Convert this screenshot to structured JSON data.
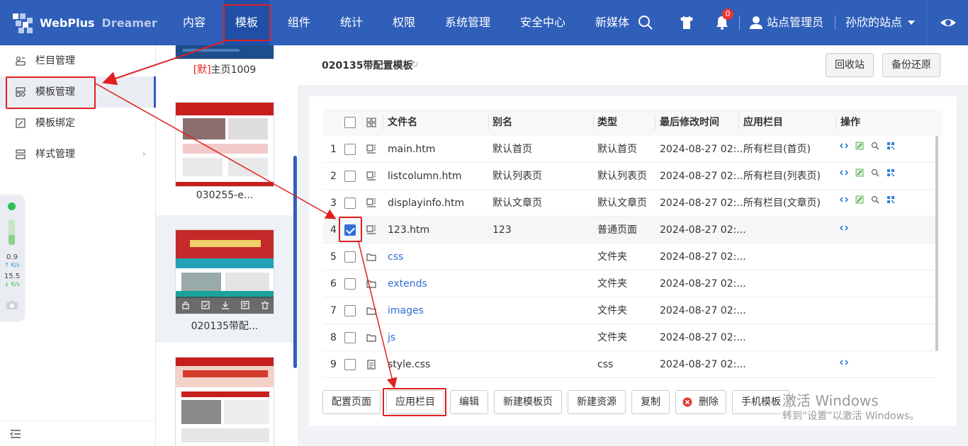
{
  "brand": {
    "name": "WebPlus",
    "sub": "Dreamer"
  },
  "nav": [
    "内容",
    "模板",
    "组件",
    "统计",
    "权限",
    "系统管理",
    "安全中心",
    "新媒体"
  ],
  "top": {
    "notifications": "0",
    "user": "站点管理员",
    "site": "孙欣的站点"
  },
  "sidebar": {
    "items": [
      {
        "label": "栏目管理",
        "icon": "columns-icon"
      },
      {
        "label": "模板管理",
        "icon": "template-icon"
      },
      {
        "label": "模板绑定",
        "icon": "bind-icon"
      },
      {
        "label": "样式管理",
        "icon": "style-icon"
      }
    ]
  },
  "widget": {
    "up_speed": "0.9",
    "up_unit": "K/s",
    "down_speed": "15.5",
    "down_unit": "K/s"
  },
  "templates": [
    {
      "name_prefix": "[默]",
      "name": "主页1009"
    },
    {
      "name": "030255-e..."
    },
    {
      "name": "020135带配..."
    },
    {
      "name": ""
    }
  ],
  "main": {
    "title": "020135带配置模板",
    "recycle": "回收站",
    "backup": "备份还原"
  },
  "table": {
    "headers": [
      "文件名",
      "别名",
      "类型",
      "最后修改时间",
      "应用栏目",
      "操作"
    ],
    "rows": [
      {
        "no": "1",
        "name": "main.htm",
        "alias": "默认首页",
        "type": "默认首页",
        "time": "2024-08-27 02:...",
        "col": "所有栏目(首页)",
        "kind": "page",
        "checked": false,
        "ops": 4
      },
      {
        "no": "2",
        "name": "listcolumn.htm",
        "alias": "默认列表页",
        "type": "默认列表页",
        "time": "2024-08-27 02:...",
        "col": "所有栏目(列表页)",
        "kind": "page",
        "checked": false,
        "ops": 4
      },
      {
        "no": "3",
        "name": "displayinfo.htm",
        "alias": "默认文章页",
        "type": "默认文章页",
        "time": "2024-08-27 02:...",
        "col": "所有栏目(文章页)",
        "kind": "page",
        "checked": false,
        "ops": 4
      },
      {
        "no": "4",
        "name": "123.htm",
        "alias": "123",
        "type": "普通页面",
        "time": "2024-08-27 02:...",
        "col": "",
        "kind": "page",
        "checked": true,
        "ops": 1
      },
      {
        "no": "5",
        "name": "css",
        "alias": "",
        "type": "文件夹",
        "time": "2024-08-27 02:...",
        "col": "",
        "kind": "folder",
        "checked": false,
        "ops": 0
      },
      {
        "no": "6",
        "name": "extends",
        "alias": "",
        "type": "文件夹",
        "time": "2024-08-27 02:...",
        "col": "",
        "kind": "folder",
        "checked": false,
        "ops": 0
      },
      {
        "no": "7",
        "name": "images",
        "alias": "",
        "type": "文件夹",
        "time": "2024-08-27 02:...",
        "col": "",
        "kind": "folder",
        "checked": false,
        "ops": 0
      },
      {
        "no": "8",
        "name": "js",
        "alias": "",
        "type": "文件夹",
        "time": "2024-08-27 02:...",
        "col": "",
        "kind": "folder",
        "checked": false,
        "ops": 0
      },
      {
        "no": "9",
        "name": "style.css",
        "alias": "",
        "type": "css",
        "time": "2024-08-27 02:...",
        "col": "",
        "kind": "file",
        "checked": false,
        "ops": 1
      }
    ]
  },
  "actions": [
    "配置页面",
    "应用栏目",
    "编辑",
    "新建模板页",
    "新建资源",
    "复制",
    "删除",
    "手机模板"
  ],
  "watermark": {
    "line1": "激活 Windows",
    "line2": "转到“设置”以激活 Windows。"
  },
  "colors": {
    "primary": "#2f5fb9",
    "highlight": "#e02020",
    "link": "#2f6fd6"
  }
}
